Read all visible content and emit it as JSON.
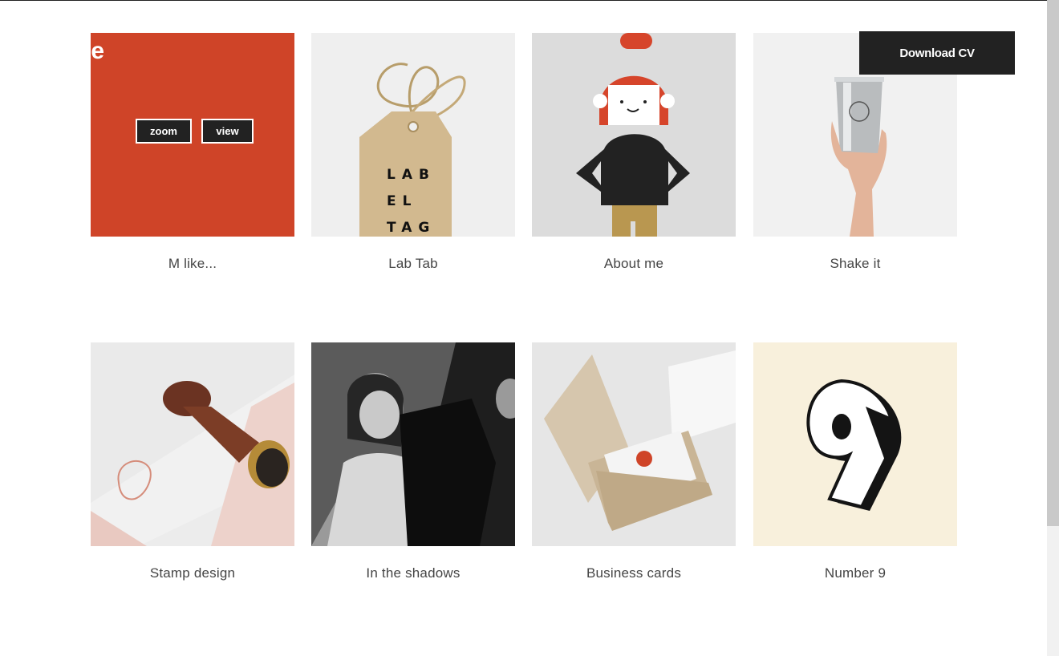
{
  "header": {
    "download_label": "Download CV"
  },
  "featured": {
    "overlay_title": "ge",
    "zoom_label": "zoom",
    "view_label": "view"
  },
  "portfolio": {
    "items": [
      {
        "title": "M like..."
      },
      {
        "title": "Lab Tab"
      },
      {
        "title": "About me"
      },
      {
        "title": "Shake it"
      },
      {
        "title": "Stamp design"
      },
      {
        "title": "In the shadows"
      },
      {
        "title": "Business cards"
      },
      {
        "title": "Number 9"
      }
    ]
  },
  "labeltag": {
    "line1": "LAB",
    "line2": "EL",
    "line3": "TAG"
  },
  "colors": {
    "accent": "#cf4428",
    "dark": "#222222",
    "cream": "#f8f0dc"
  }
}
